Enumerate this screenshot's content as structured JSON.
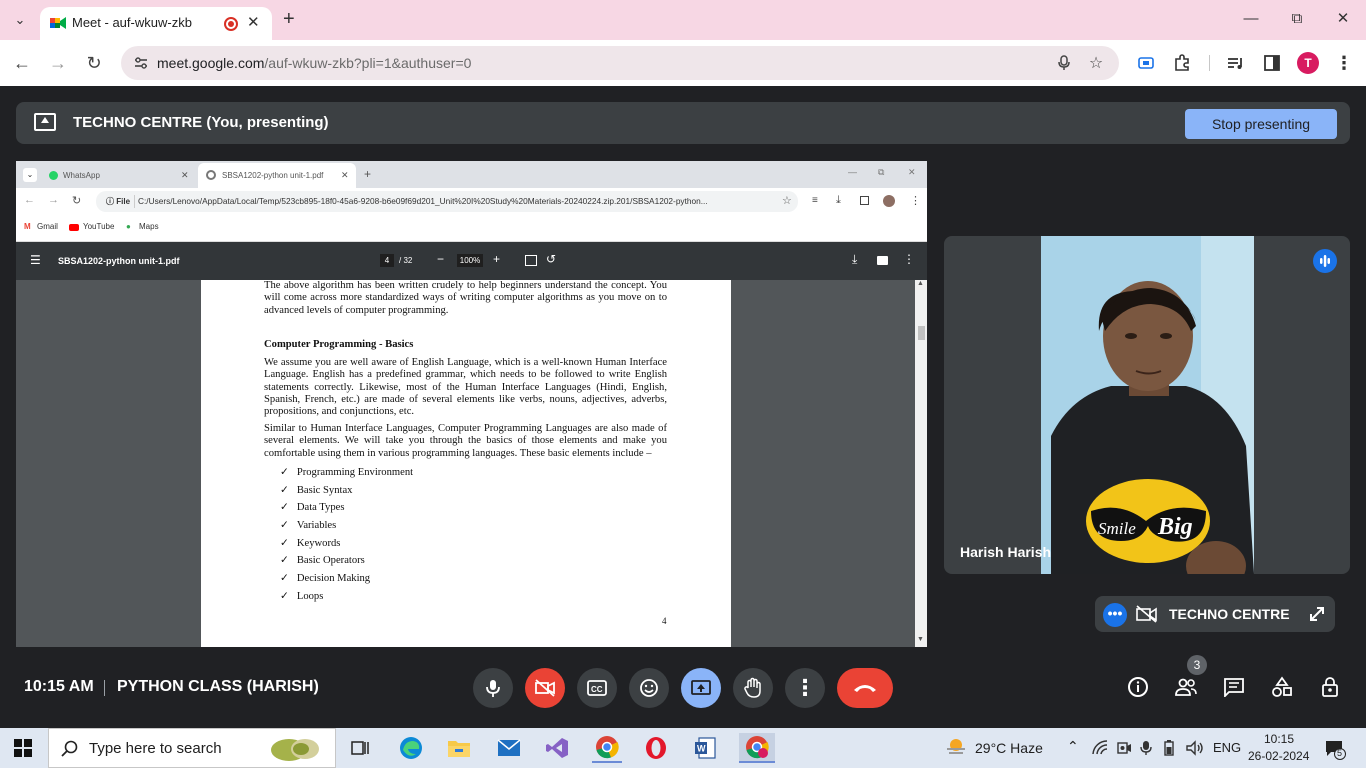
{
  "browser": {
    "tab_title": "Meet - auf-wkuw-zkb",
    "url_host": "meet.google.com",
    "url_path": "/auf-wkuw-zkb?pli=1&authuser=0",
    "profile_initial": "T"
  },
  "meet": {
    "presenting_label": "TECHNO CENTRE (You, presenting)",
    "stop_presenting_label": "Stop presenting",
    "participant_name": "Harish Harish",
    "self_name": "TECHNO CENTRE",
    "meeting_time": "10:15 AM",
    "meeting_title": "PYTHON CLASS (HARISH)",
    "people_count": "3"
  },
  "shared_screen": {
    "tabs": [
      "WhatsApp",
      "SBSA1202-python unit-1.pdf"
    ],
    "file_chip": "File",
    "url": "C:/Users/Lenovo/AppData/Local/Temp/523cb895-18f0-45a6-9208-b6e09f69d201_Unit%20I%20Study%20Materials-20240224.zip.201/SBSA1202-python...",
    "bookmarks": [
      "Gmail",
      "YouTube",
      "Maps"
    ],
    "pdf": {
      "title": "SBSA1202-python unit-1.pdf",
      "page_current": "4",
      "page_total": "/ 32",
      "zoom": "100%",
      "para1": "The above algorithm has been written crudely to help beginners understand the concept. You will come across more standardized ways of writing computer algorithms as you move on to advanced levels of computer programming.",
      "heading": "Computer Programming - Basics",
      "para2": "We assume you are well aware of English Language, which is a well-known Human Interface Language. English has a predefined grammar, which needs to be followed to write English statements correctly. Likewise, most of the Human Interface Languages (Hindi, English, Spanish, French, etc.) are made of several elements like verbs, nouns, adjectives, adverbs, propositions, and conjunctions, etc.",
      "para3": "Similar to Human Interface Languages, Computer Programming Languages are also made of several elements. We will take you through the basics of those elements and make you comfortable using them in various programming languages. These basic elements include –",
      "bullets": [
        "Programming Environment",
        "Basic Syntax",
        "Data Types",
        "Variables",
        "Keywords",
        "Basic Operators",
        "Decision Making",
        "Loops"
      ],
      "page_number": "4"
    }
  },
  "video": {
    "shirt_text_left": "Smile",
    "shirt_text_right": "Big"
  },
  "taskbar": {
    "search_placeholder": "Type here to search",
    "weather": "29°C  Haze",
    "language": "ENG",
    "time": "10:15",
    "date": "26-02-2024",
    "notifications": "5"
  },
  "colors": {
    "meet_bg": "#202124",
    "stop_button": "#8ab4f8",
    "end_call": "#ea4335",
    "active_blue": "#8ab4f8",
    "tabstrip": "#f7d7e4"
  }
}
